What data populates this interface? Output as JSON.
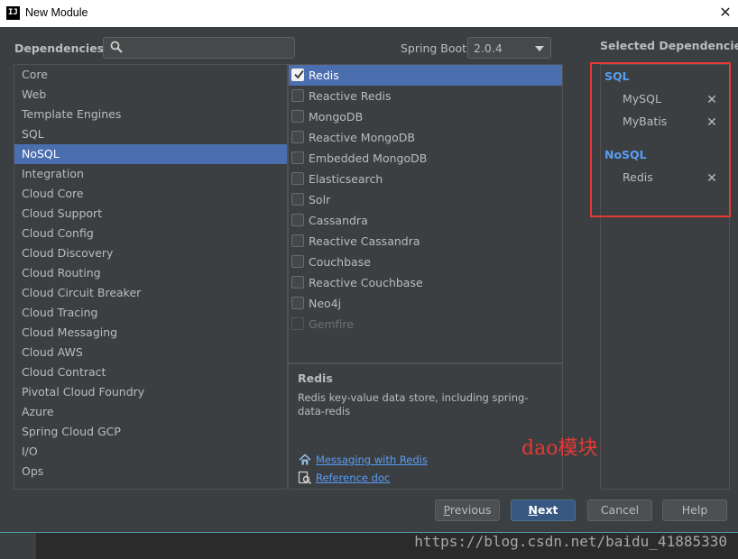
{
  "window": {
    "title": "New Module",
    "app_icon_text": "IJ"
  },
  "header": {
    "dependencies_label": "Dependencies",
    "search_placeholder": "",
    "spring_boot_label": "Spring Boot",
    "spring_boot_version": "2.0.4",
    "selected_dependencies_label": "Selected Dependencies"
  },
  "categories": [
    "Core",
    "Web",
    "Template Engines",
    "SQL",
    "NoSQL",
    "Integration",
    "Cloud Core",
    "Cloud Support",
    "Cloud Config",
    "Cloud Discovery",
    "Cloud Routing",
    "Cloud Circuit Breaker",
    "Cloud Tracing",
    "Cloud Messaging",
    "Cloud AWS",
    "Cloud Contract",
    "Pivotal Cloud Foundry",
    "Azure",
    "Spring Cloud GCP",
    "I/O",
    "Ops"
  ],
  "selected_category": "NoSQL",
  "dependencies": [
    {
      "label": "Redis",
      "checked": true,
      "selected": true,
      "enabled": true
    },
    {
      "label": "Reactive Redis",
      "checked": false,
      "selected": false,
      "enabled": true
    },
    {
      "label": "MongoDB",
      "checked": false,
      "selected": false,
      "enabled": true
    },
    {
      "label": "Reactive MongoDB",
      "checked": false,
      "selected": false,
      "enabled": true
    },
    {
      "label": "Embedded MongoDB",
      "checked": false,
      "selected": false,
      "enabled": true
    },
    {
      "label": "Elasticsearch",
      "checked": false,
      "selected": false,
      "enabled": true
    },
    {
      "label": "Solr",
      "checked": false,
      "selected": false,
      "enabled": true
    },
    {
      "label": "Cassandra",
      "checked": false,
      "selected": false,
      "enabled": true
    },
    {
      "label": "Reactive Cassandra",
      "checked": false,
      "selected": false,
      "enabled": true
    },
    {
      "label": "Couchbase",
      "checked": false,
      "selected": false,
      "enabled": true
    },
    {
      "label": "Reactive Couchbase",
      "checked": false,
      "selected": false,
      "enabled": true
    },
    {
      "label": "Neo4j",
      "checked": false,
      "selected": false,
      "enabled": true
    },
    {
      "label": "Gemfire",
      "checked": false,
      "selected": false,
      "enabled": false
    }
  ],
  "description": {
    "title": "Redis",
    "text": "Redis key-value data store, including spring-data-redis",
    "links": [
      {
        "label": "Messaging with Redis",
        "icon": "home-icon"
      },
      {
        "label": "Reference doc",
        "icon": "doc-search-icon"
      }
    ]
  },
  "selected_dependencies": {
    "groups": [
      {
        "name": "SQL",
        "items": [
          "MySQL",
          "MyBatis"
        ]
      },
      {
        "name": "NoSQL",
        "items": [
          "Redis"
        ]
      }
    ],
    "remove_glyph": "✕"
  },
  "annotation": "dao模块",
  "buttons": {
    "previous": "Previous",
    "next": "Next",
    "cancel": "Cancel",
    "help": "Help"
  },
  "watermark": "https://blog.csdn.net/baidu_41885330",
  "colors": {
    "background": "#3c3f41",
    "selection": "#4b6eaf",
    "link": "#589df6",
    "annotation_red": "#e53935",
    "primary_button": "#365880"
  }
}
